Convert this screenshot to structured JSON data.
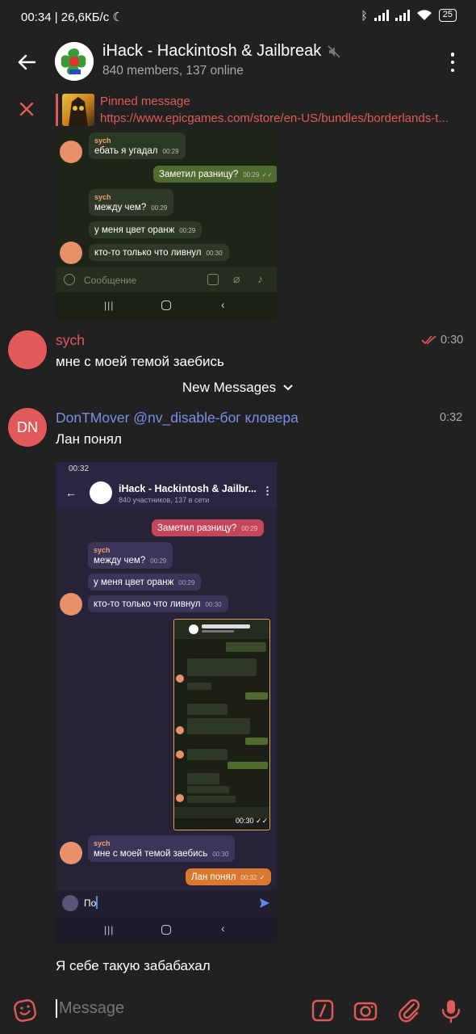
{
  "status_bar": {
    "time": "00:34",
    "speed": "26,6КБ/с",
    "battery": "25"
  },
  "header": {
    "title": "iHack - Hackintosh & Jailbreak",
    "subtitle": "840 members, 137 online"
  },
  "pinned": {
    "title": "Pinned message",
    "text": "https://www.epicgames.com/store/en-US/bundles/borderlands-t..."
  },
  "screenshot1": {
    "messages": [
      {
        "sender": "sych",
        "text": "ебать я угадал",
        "time": "00:29"
      },
      {
        "text": "Заметил разницу?",
        "time": "00:29"
      },
      {
        "sender": "sych",
        "text": "между чем?",
        "time": "00:29"
      },
      {
        "text": "у меня цвет оранж",
        "time": "00:29"
      },
      {
        "text": "кто-то только что ливнул",
        "time": "00:30"
      }
    ],
    "input_placeholder": "Сообщение"
  },
  "messages": [
    {
      "sender": "sych",
      "text": "мне с моей темой заебись",
      "time": "0:30"
    },
    {
      "sender": "DonTMover @nv_disable-бог кловера",
      "avatar": "DN",
      "text": "Лан понял",
      "time": "0:32"
    }
  ],
  "new_messages_label": "New Messages",
  "screenshot2": {
    "status_time": "00:32",
    "title": "iHack - Hackintosh & Jailbr...",
    "subtitle": "840 участников, 137 в сети",
    "messages": [
      {
        "text": "Заметил разницу?",
        "time": "00:29"
      },
      {
        "sender": "sych",
        "text": "между чем?",
        "time": "00:29"
      },
      {
        "text": "у меня цвет оранж",
        "time": "00:29"
      },
      {
        "text": "кто-то только что ливнул",
        "time": "00:30"
      },
      {
        "sender": "sych",
        "text": "мне с моей темой заебись",
        "time": "00:30"
      },
      {
        "text": "Лан понял",
        "time": "00:32"
      }
    ],
    "input_value": "По",
    "nested_time": "00:30"
  },
  "last_message": {
    "text": "Я себе такую забабахал"
  },
  "input": {
    "placeholder": "Message"
  },
  "colors": {
    "accent": "#e05a59",
    "name_blue": "#7e8de6",
    "background": "#212121"
  }
}
